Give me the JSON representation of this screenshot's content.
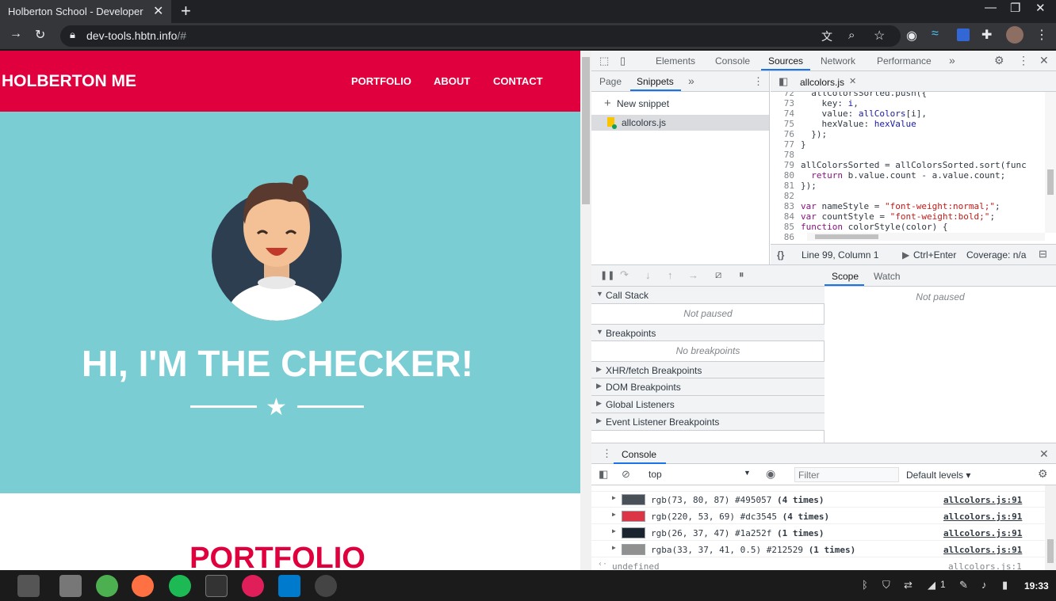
{
  "browser": {
    "tab_title": "Holberton School - Developer",
    "tab_close": "✕",
    "new_tab": "+",
    "url_main": "dev-tools.hbtn.info",
    "url_rest": "/#",
    "window_controls": {
      "minimize": "—",
      "restore": "❐",
      "close": "✕"
    }
  },
  "page": {
    "brand": "HOLBERTON ME",
    "nav": [
      "PORTFOLIO",
      "ABOUT",
      "CONTACT"
    ],
    "hero_title": "HI, I'M THE CHECKER!",
    "section_title": "PORTFOLIO",
    "colors": {
      "nav_bg": "#e1003e",
      "hero_bg": "#7acdd3"
    }
  },
  "devtools": {
    "main_tabs": [
      "Elements",
      "Console",
      "Sources",
      "Network",
      "Performance"
    ],
    "more_tabs": "»",
    "navigator_tabs": [
      "Page",
      "Snippets"
    ],
    "new_snippet": "New snippet",
    "file_name": "allcolors.js",
    "editor_tab": "allcolors.js",
    "code_lines": [
      {
        "n": "72",
        "t": "  allColorsSorted.push({"
      },
      {
        "n": "73",
        "t": "    key: i,"
      },
      {
        "n": "74",
        "t": "    value: allColors[i],"
      },
      {
        "n": "75",
        "t": "    hexValue: hexValue"
      },
      {
        "n": "76",
        "t": "  });"
      },
      {
        "n": "77",
        "t": "}"
      },
      {
        "n": "78",
        "t": ""
      },
      {
        "n": "79",
        "t": "allColorsSorted = allColorsSorted.sort(func"
      },
      {
        "n": "80",
        "t": "  return b.value.count - a.value.count;"
      },
      {
        "n": "81",
        "t": "});"
      },
      {
        "n": "82",
        "t": ""
      },
      {
        "n": "83",
        "t": "var nameStyle = \"font-weight:normal;\";"
      },
      {
        "n": "84",
        "t": "var countStyle = \"font-weight:bold;\";"
      },
      {
        "n": "85",
        "t": "function colorStyle(color) {"
      },
      {
        "n": "86",
        "t": ""
      }
    ],
    "editor_status": {
      "braces": "{}",
      "position": "Line 99, Column 1",
      "run": "Ctrl+Enter",
      "coverage": "Coverage: n/a"
    },
    "call_stack": "Call Stack",
    "not_paused": "Not paused",
    "breakpoints": "Breakpoints",
    "no_breakpoints": "No breakpoints",
    "sections": [
      "XHR/fetch Breakpoints",
      "DOM Breakpoints",
      "Global Listeners",
      "Event Listener Breakpoints"
    ],
    "scope_tabs": [
      "Scope",
      "Watch"
    ],
    "scope_not_paused": "Not paused",
    "drawer_tab": "Console",
    "context": "top",
    "filter_placeholder": "Filter",
    "levels": "Default levels ▾",
    "logs": [
      {
        "text": "rgb(73, 80, 87) #495057 ",
        "count": "(4 times)",
        "color": "#495057",
        "src": "allcolors.js:91"
      },
      {
        "text": "rgb(220, 53, 69) #dc3545 ",
        "count": "(4 times)",
        "color": "#dc3545",
        "src": "allcolors.js:91"
      },
      {
        "text": "rgb(26, 37, 47) #1a252f ",
        "count": "(1 times)",
        "color": "#1a252f",
        "src": "allcolors.js:91"
      },
      {
        "text": "rgba(33, 37, 41, 0.5) #212529 ",
        "count": "(1 times)",
        "color": "#909090",
        "src": "allcolors.js:91"
      }
    ],
    "result": "undefined",
    "result_src": "allcolors.js:1"
  },
  "taskbar": {
    "clock": "19:33",
    "battery_count": "1"
  }
}
